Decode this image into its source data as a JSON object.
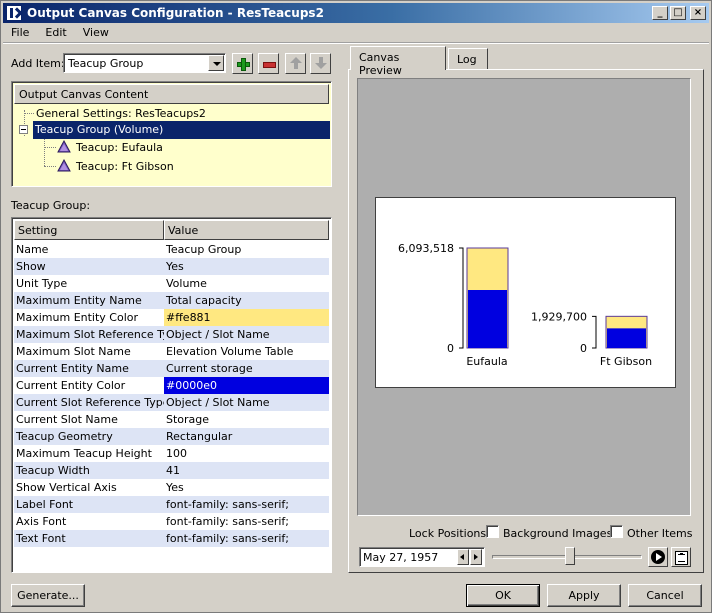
{
  "window": {
    "title": "Output Canvas Configuration - ResTeacups2",
    "controls": {
      "minimize": "_",
      "maximize": "□",
      "close": "×"
    }
  },
  "menu": {
    "items": [
      "File",
      "Edit",
      "View"
    ]
  },
  "add_item": {
    "label": "Add Item:",
    "selected": "Teacup Group",
    "icons": [
      "add-icon",
      "remove-icon",
      "move-up-icon",
      "move-down-icon"
    ]
  },
  "tree": {
    "header": "Output Canvas Content",
    "items": [
      {
        "label": "General Settings: ResTeacups2",
        "level": 0
      },
      {
        "label": "Teacup Group (Volume)",
        "level": 0,
        "selected": true
      },
      {
        "label": "Teacup: Eufaula",
        "level": 1
      },
      {
        "label": "Teacup: Ft Gibson",
        "level": 1
      }
    ]
  },
  "settings": {
    "section_label": "Teacup Group:",
    "headers": [
      "Setting",
      "Value"
    ],
    "rows": [
      {
        "setting": "Name",
        "value": "Teacup Group"
      },
      {
        "setting": "Show",
        "value": "Yes"
      },
      {
        "setting": "Unit Type",
        "value": "Volume"
      },
      {
        "setting": "Maximum Entity Name",
        "value": "Total capacity"
      },
      {
        "setting": "Maximum Entity Color",
        "value": "#ffe881",
        "swatch": "#ffe881"
      },
      {
        "setting": "Maximum Slot Reference Type",
        "value": "Object / Slot Name"
      },
      {
        "setting": "Maximum Slot Name",
        "value": "Elevation Volume Table"
      },
      {
        "setting": "Current Entity Name",
        "value": "Current storage"
      },
      {
        "setting": "Current Entity Color",
        "value": "#0000e0",
        "swatch": "#0000e0",
        "swatch_text": "#ffffff"
      },
      {
        "setting": "Current Slot Reference Type",
        "value": "Object / Slot Name"
      },
      {
        "setting": "Current Slot Name",
        "value": "Storage"
      },
      {
        "setting": "Teacup Geometry",
        "value": "Rectangular"
      },
      {
        "setting": "Maximum Teacup Height",
        "value": "100"
      },
      {
        "setting": "Teacup Width",
        "value": "41"
      },
      {
        "setting": "Show Vertical Axis",
        "value": "Yes"
      },
      {
        "setting": "Label Font",
        "value": "font-family: sans-serif;"
      },
      {
        "setting": "Axis Font",
        "value": "font-family: sans-serif;"
      },
      {
        "setting": "Text Font",
        "value": "font-family: sans-serif;"
      }
    ]
  },
  "tabs": [
    {
      "label": "Canvas Preview",
      "active": true
    },
    {
      "label": "Log",
      "active": false
    }
  ],
  "preview": {
    "colors": {
      "max": "#ffe881",
      "current": "#0000e0",
      "outline": "#5a3a9a"
    },
    "teacups": [
      {
        "name": "Eufaula",
        "max_label": "6,093,518",
        "zero_label": "0",
        "max_value": 6093518,
        "current_fraction": 0.58
      },
      {
        "name": "Ft Gibson",
        "max_label": "1,929,700",
        "zero_label": "0",
        "max_value": 1929700,
        "current_fraction": 0.62
      }
    ]
  },
  "lock_positions": {
    "label": "Lock Positions:",
    "background_images": {
      "label": "Background Images",
      "checked": false
    },
    "other_items": {
      "label": "Other Items",
      "checked": false
    }
  },
  "timeline": {
    "date": "May 27, 1957",
    "slider_fraction": 0.52
  },
  "buttons": {
    "generate": "Generate...",
    "ok": "OK",
    "apply": "Apply",
    "cancel": "Cancel"
  }
}
